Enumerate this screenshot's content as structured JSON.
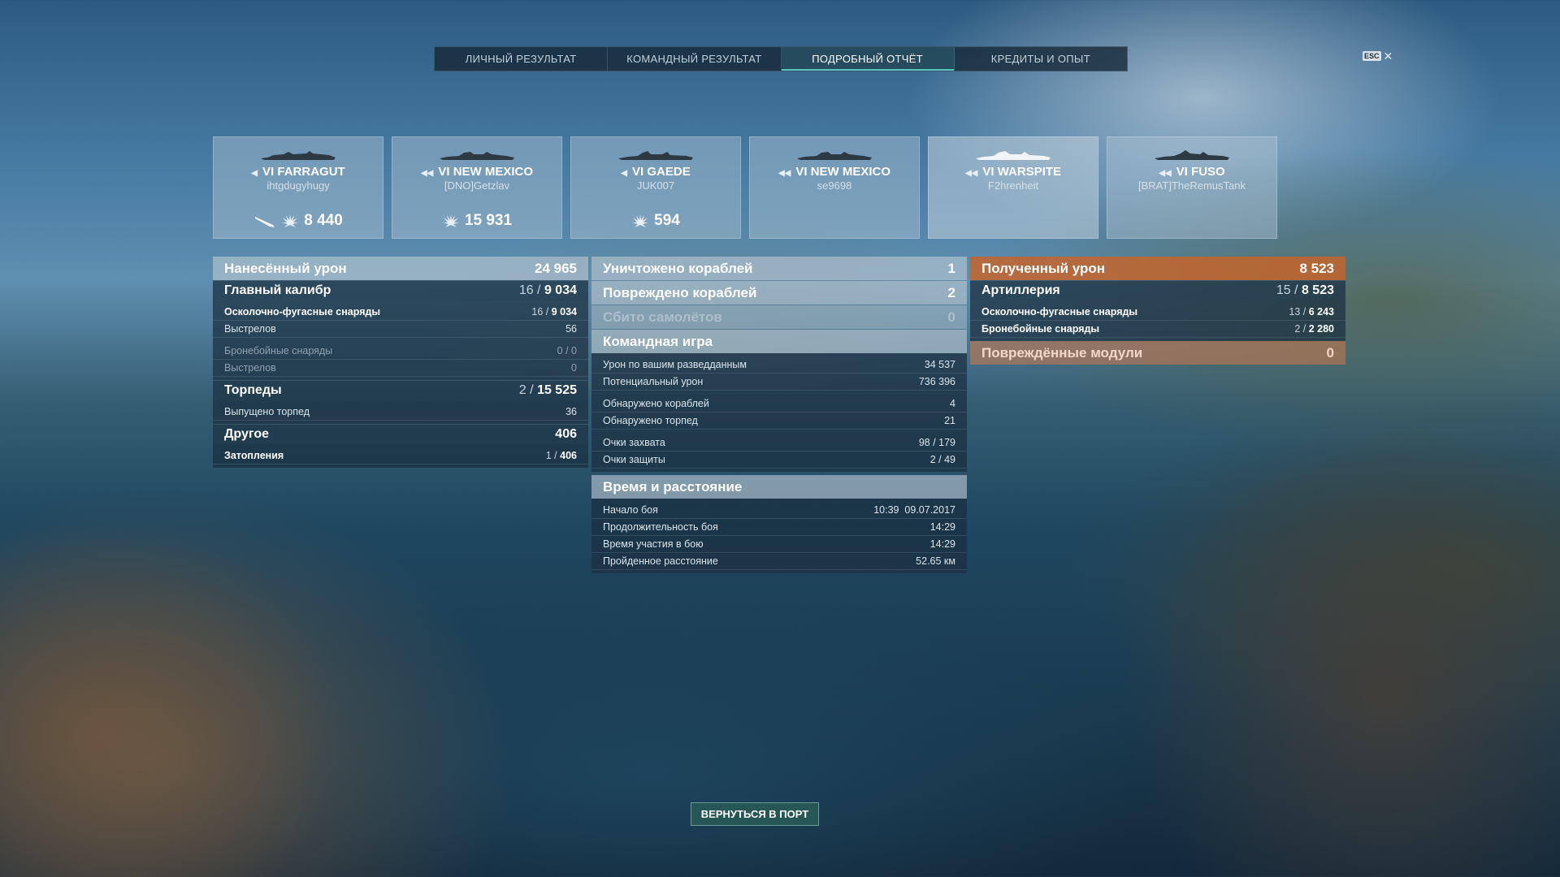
{
  "tabs": [
    "ЛИЧНЫЙ РЕЗУЛЬТАТ",
    "КОМАНДНЫЙ РЕЗУЛЬТАТ",
    "ПОДРОБНЫЙ ОТЧЁТ",
    "КРЕДИТЫ И ОПЫТ"
  ],
  "active_tab": "ПОДРОБНЫЙ ОТЧЁТ",
  "esc_label": "ESC",
  "ships": [
    {
      "tier": "VI",
      "name": "FARRAGUT",
      "player": "ihtgdugyhugy",
      "damage": "8 440",
      "icon": "destroyer-icon",
      "torpedo": true
    },
    {
      "tier": "VI",
      "name": "NEW MEXICO",
      "player": "[DNO]Getzlav",
      "damage": "15 931",
      "icon": "battleship-icon",
      "torpedo": false
    },
    {
      "tier": "VI",
      "name": "GAEDE",
      "player": "JUK007",
      "damage": "594",
      "icon": "destroyer-icon",
      "torpedo": false
    },
    {
      "tier": "VI",
      "name": "NEW MEXICO",
      "player": "se9698",
      "damage": "",
      "icon": "battleship-icon",
      "torpedo": false
    },
    {
      "tier": "VI",
      "name": "WARSPITE",
      "player": "F2hrenheit",
      "damage": "",
      "icon": "battleship-icon",
      "torpedo": false
    },
    {
      "tier": "VI",
      "name": "FUSO",
      "player": "[BRAT]TheRemusTank",
      "damage": "",
      "icon": "battleship-icon",
      "torpedo": false
    }
  ],
  "left": {
    "total": {
      "label": "Нанесённый урон",
      "value": "24 965"
    },
    "main_caliber": {
      "label": "Главный калибр",
      "pre": "16 /",
      "value": "9 034"
    },
    "he": {
      "label": "Осколочно-фугасные снаряды",
      "pre": "16 /",
      "value": "9 034"
    },
    "he_shots": {
      "label": "Выстрелов",
      "value": "56"
    },
    "ap": {
      "label": "Бронебойные снаряды",
      "value": "0 / 0"
    },
    "ap_shots": {
      "label": "Выстрелов",
      "value": "0"
    },
    "torpedoes": {
      "label": "Торпеды",
      "pre": "2 /",
      "value": "15 525"
    },
    "torps_fired": {
      "label": "Выпущено торпед",
      "value": "36"
    },
    "other": {
      "label": "Другое",
      "value": "406"
    },
    "flooding": {
      "label": "Затопления",
      "pre": "1 /",
      "value": "406"
    }
  },
  "middle": {
    "destroyed": {
      "label": "Уничтожено кораблей",
      "value": "1"
    },
    "damaged": {
      "label": "Повреждено кораблей",
      "value": "2"
    },
    "planes": {
      "label": "Сбито самолётов",
      "value": "0"
    },
    "team_title": "Командная игра",
    "team_rows": [
      {
        "label": "Урон по вашим разведданным",
        "value": "34 537"
      },
      {
        "label": "Потенциальный урон",
        "value": "736 396"
      },
      {
        "label": "Обнаружено кораблей",
        "value": "4"
      },
      {
        "label": "Обнаружено торпед",
        "value": "21"
      },
      {
        "label": "Очки захвата",
        "value": "98 / 179"
      },
      {
        "label": "Очки защиты",
        "value": "2 / 49"
      }
    ],
    "time_title": "Время и расстояние",
    "time_rows": [
      {
        "label": "Начало боя",
        "value": "10:39  09.07.2017"
      },
      {
        "label": "Продолжительность боя",
        "value": "14:29"
      },
      {
        "label": "Время участия в бою",
        "value": "14:29"
      },
      {
        "label": "Пройденное расстояние",
        "value": "52.65 км"
      }
    ]
  },
  "right": {
    "received": {
      "label": "Полученный урон",
      "value": "8 523"
    },
    "artillery": {
      "label": "Артиллерия",
      "pre": "15 /",
      "value": "8 523"
    },
    "he": {
      "label": "Осколочно-фугасные снаряды",
      "pre": "13 /",
      "value": "6 243"
    },
    "ap": {
      "label": "Бронебойные снаряды",
      "pre": "2 /",
      "value": "2 280"
    },
    "modules": {
      "label": "Повреждённые модули",
      "value": "0"
    }
  },
  "back_button": "ВЕРНУТЬСЯ В ПОРТ",
  "colors": {
    "accent": "#58c4bf",
    "received": "#c8642a"
  }
}
